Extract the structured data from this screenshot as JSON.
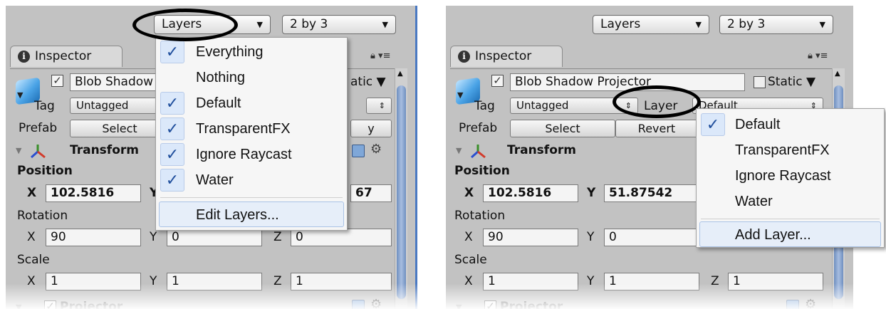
{
  "toolbar": {
    "layers_label": "Layers",
    "layout_label": "2 by 3"
  },
  "inspector": {
    "tab_label": "Inspector",
    "object_name": "Blob Shadow Projector",
    "object_name_clipped": "Blob Shadow",
    "static_label": "Static",
    "static_clipped": "atic",
    "tag_label": "Tag",
    "tag_value": "Untagged",
    "layer_label": "Layer",
    "layer_value": "Default",
    "prefab_label": "Prefab",
    "prefab_select": "Select",
    "prefab_revert": "Revert",
    "transform_title": "Transform",
    "position_label": "Position",
    "pos_x_label": "X",
    "pos_x": "102.5816",
    "pos_y_label": "Y",
    "pos_y": "51.87542",
    "pos_z_clipped": "67",
    "rotation_label": "Rotation",
    "rot_x_label": "X",
    "rot_x": "90",
    "rot_y_label": "Y",
    "rot_y": "0",
    "rot_z_label": "Z",
    "rot_z": "0",
    "scale_label": "Scale",
    "scale_x_label": "X",
    "scale_x": "1",
    "scale_y_label": "Y",
    "scale_y": "1",
    "scale_z_label": "Z",
    "scale_z": "1",
    "projector_title": "Projector"
  },
  "layers_menu": {
    "items": [
      {
        "label": "Everything",
        "checked": true
      },
      {
        "label": "Nothing",
        "checked": false
      },
      {
        "label": "Default",
        "checked": true
      },
      {
        "label": "TransparentFX",
        "checked": true
      },
      {
        "label": "Ignore Raycast",
        "checked": true
      },
      {
        "label": "Water",
        "checked": true
      }
    ],
    "footer": "Edit Layers..."
  },
  "layer_menu": {
    "items": [
      {
        "label": "Default",
        "checked": true
      },
      {
        "label": "TransparentFX",
        "checked": false
      },
      {
        "label": "Ignore Raycast",
        "checked": false
      },
      {
        "label": "Water",
        "checked": false
      }
    ],
    "footer": "Add Layer..."
  },
  "glyphs": {
    "check": "✓",
    "arrow_down": "▼",
    "updown": "⇕",
    "triangle": "▼",
    "gear": "⚙",
    "up": "▲"
  },
  "colors": {
    "panel_bg": "#c2c2c2",
    "menu_check_bg": "#dbe8fa",
    "accent_blue": "#1f4e9c",
    "edge_blue": "#4a79c2"
  }
}
